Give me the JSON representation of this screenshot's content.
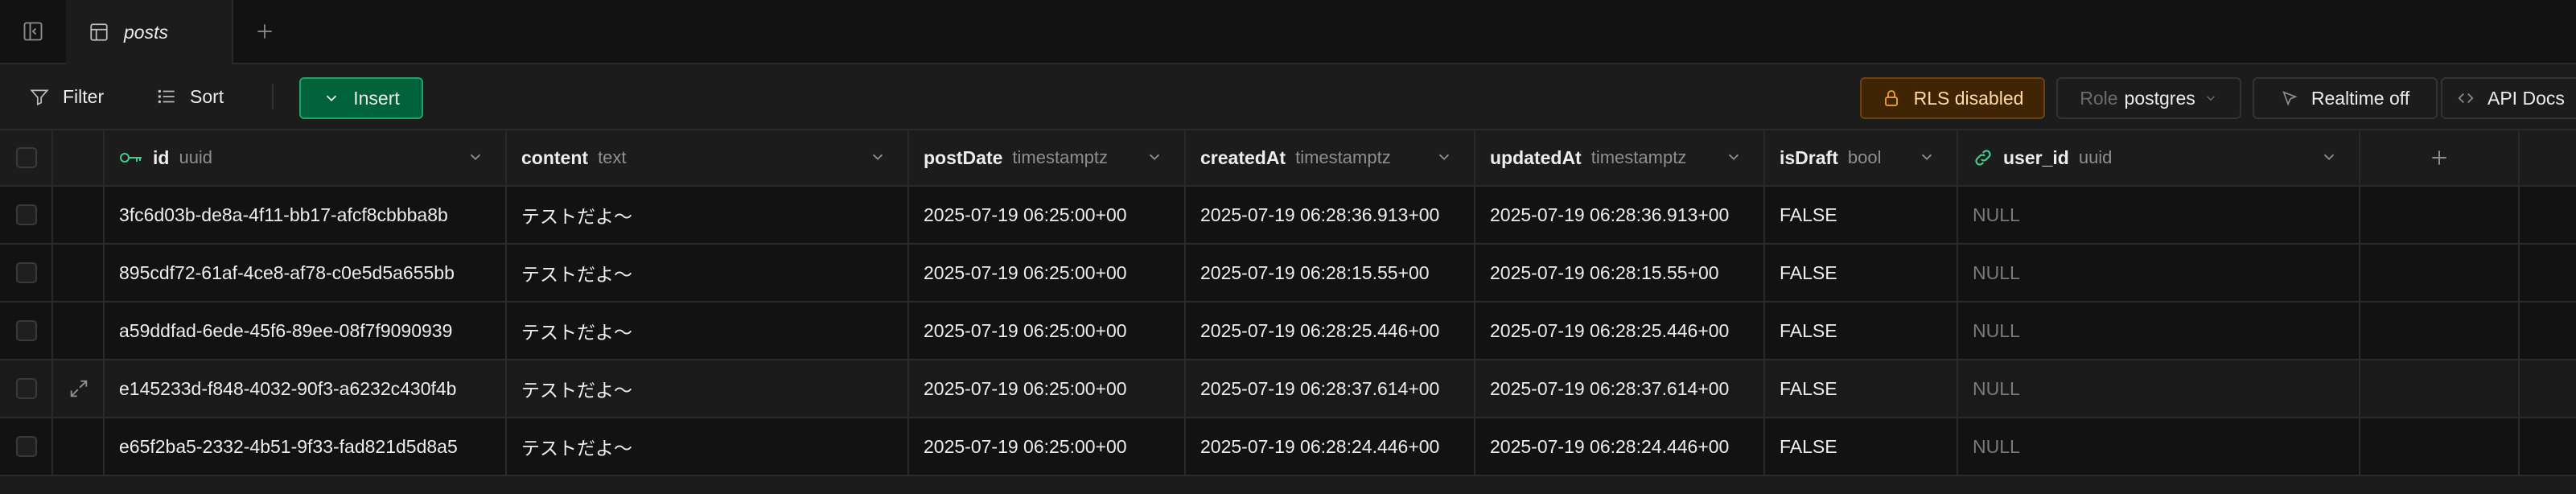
{
  "tabs": [
    {
      "label": "posts",
      "icon": "table-icon"
    }
  ],
  "toolbar": {
    "filter_label": "Filter",
    "sort_label": "Sort",
    "insert_label": "Insert",
    "rls_label": "RLS disabled",
    "role_key": "Role",
    "role_value": "postgres",
    "realtime_label": "Realtime off",
    "api_label": "API Docs"
  },
  "columns": [
    {
      "name": "id",
      "type": "uuid",
      "icon": "key-icon"
    },
    {
      "name": "content",
      "type": "text"
    },
    {
      "name": "postDate",
      "type": "timestamptz"
    },
    {
      "name": "createdAt",
      "type": "timestamptz"
    },
    {
      "name": "updatedAt",
      "type": "timestamptz"
    },
    {
      "name": "isDraft",
      "type": "bool"
    },
    {
      "name": "user_id",
      "type": "uuid",
      "icon": "link-icon"
    }
  ],
  "rows": [
    {
      "id": "3fc6d03b-de8a-4f11-bb17-afcf8cbbba8b",
      "content": "テストだよ〜",
      "postDate": "2025-07-19 06:25:00+00",
      "createdAt": "2025-07-19 06:28:36.913+00",
      "updatedAt": "2025-07-19 06:28:36.913+00",
      "isDraft": "FALSE",
      "user_id": "NULL"
    },
    {
      "id": "895cdf72-61af-4ce8-af78-c0e5d5a655bb",
      "content": "テストだよ〜",
      "postDate": "2025-07-19 06:25:00+00",
      "createdAt": "2025-07-19 06:28:15.55+00",
      "updatedAt": "2025-07-19 06:28:15.55+00",
      "isDraft": "FALSE",
      "user_id": "NULL"
    },
    {
      "id": "a59ddfad-6ede-45f6-89ee-08f7f9090939",
      "content": "テストだよ〜",
      "postDate": "2025-07-19 06:25:00+00",
      "createdAt": "2025-07-19 06:28:25.446+00",
      "updatedAt": "2025-07-19 06:28:25.446+00",
      "isDraft": "FALSE",
      "user_id": "NULL"
    },
    {
      "id": "e145233d-f848-4032-90f3-a6232c430f4b",
      "content": "テストだよ〜",
      "postDate": "2025-07-19 06:25:00+00",
      "createdAt": "2025-07-19 06:28:37.614+00",
      "updatedAt": "2025-07-19 06:28:37.614+00",
      "isDraft": "FALSE",
      "user_id": "NULL"
    },
    {
      "id": "e65f2ba5-2332-4b51-9f33-fad821d5d8a5",
      "content": "テストだよ〜",
      "postDate": "2025-07-19 06:25:00+00",
      "createdAt": "2025-07-19 06:28:24.446+00",
      "updatedAt": "2025-07-19 06:28:24.446+00",
      "isDraft": "FALSE",
      "user_id": "NULL"
    }
  ],
  "colors": {
    "background": "#1c1c1c",
    "insert_accent": "#006239",
    "rls_warning": "#3f2504"
  }
}
